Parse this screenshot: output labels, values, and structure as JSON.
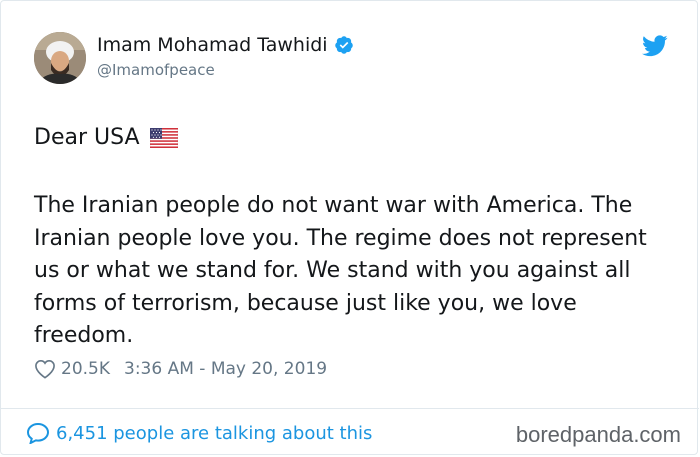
{
  "tweet": {
    "display_name": "Imam Mohamad Tawhidi",
    "handle": "@Imamofpeace",
    "verified": true,
    "greeting": "Dear USA",
    "flag_icon": "us-flag-icon",
    "body": "The Iranian people do not want war with America. The Iranian people love you. The regime does not represent us or what we stand for. We stand with you against all forms of terrorism, because just like you, we love freedom.",
    "likes": "20.5K",
    "timestamp": "3:36 AM - May 20, 2019"
  },
  "footer": {
    "talking": "6,451 people are talking about this",
    "watermark": "boredpanda.com"
  },
  "colors": {
    "twitter_blue": "#1da1f2",
    "link_blue": "#1b95e0",
    "muted": "#657786",
    "border": "#e1e8ed"
  }
}
